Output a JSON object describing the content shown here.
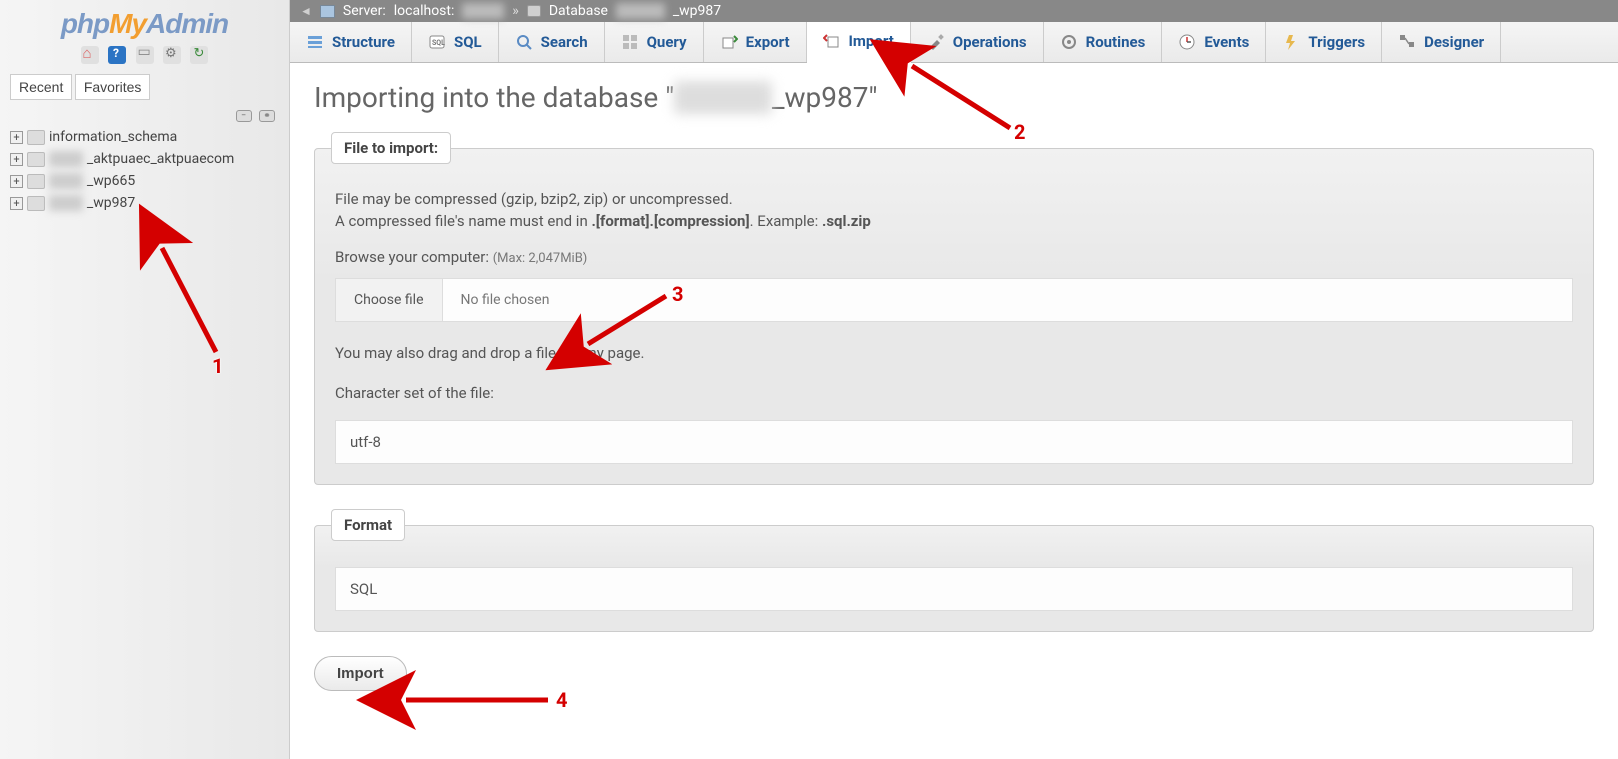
{
  "logo": {
    "part1": "php",
    "part2": "My",
    "part3": "Admin"
  },
  "sidebar": {
    "recent_label": "Recent",
    "favorites_label": "Favorites",
    "databases": [
      {
        "name": "information_schema",
        "blurred": false
      },
      {
        "name": "_aktpuaec_aktpuaecom",
        "blurred": true
      },
      {
        "name": "_wp665",
        "blurred": true
      },
      {
        "name": "_wp987",
        "blurred": true
      }
    ]
  },
  "breadcrumb": {
    "server_label": "Server:",
    "server_value": "localhost:",
    "database_label": "Database",
    "database_suffix": "_wp987"
  },
  "tabs": [
    {
      "id": "structure",
      "label": "Structure"
    },
    {
      "id": "sql",
      "label": "SQL"
    },
    {
      "id": "search",
      "label": "Search"
    },
    {
      "id": "query",
      "label": "Query"
    },
    {
      "id": "export",
      "label": "Export"
    },
    {
      "id": "import",
      "label": "Import",
      "active": true
    },
    {
      "id": "operations",
      "label": "Operations"
    },
    {
      "id": "routines",
      "label": "Routines"
    },
    {
      "id": "events",
      "label": "Events"
    },
    {
      "id": "triggers",
      "label": "Triggers"
    },
    {
      "id": "designer",
      "label": "Designer"
    }
  ],
  "page": {
    "title_prefix": "Importing into the database \"",
    "title_suffix": "_wp987\"",
    "fieldset1_legend": "File to import:",
    "hint1": "File may be compressed (gzip, bzip2, zip) or uncompressed.",
    "hint2_pre": "A compressed file's name must end in ",
    "hint2_b1": ".[format].[compression]",
    "hint2_mid": ". Example: ",
    "hint2_b2": ".sql.zip",
    "browse_label": "Browse your computer:",
    "browse_max": "(Max: 2,047MiB)",
    "choose_btn": "Choose file",
    "choose_state": "No file chosen",
    "dragdrop": "You may also drag and drop a file on any page.",
    "charset_label": "Character set of the file:",
    "charset_value": "utf-8",
    "fieldset2_legend": "Format",
    "format_value": "SQL",
    "submit_label": "Import"
  },
  "annotations": {
    "n1": "1",
    "n2": "2",
    "n3": "3",
    "n4": "4"
  }
}
